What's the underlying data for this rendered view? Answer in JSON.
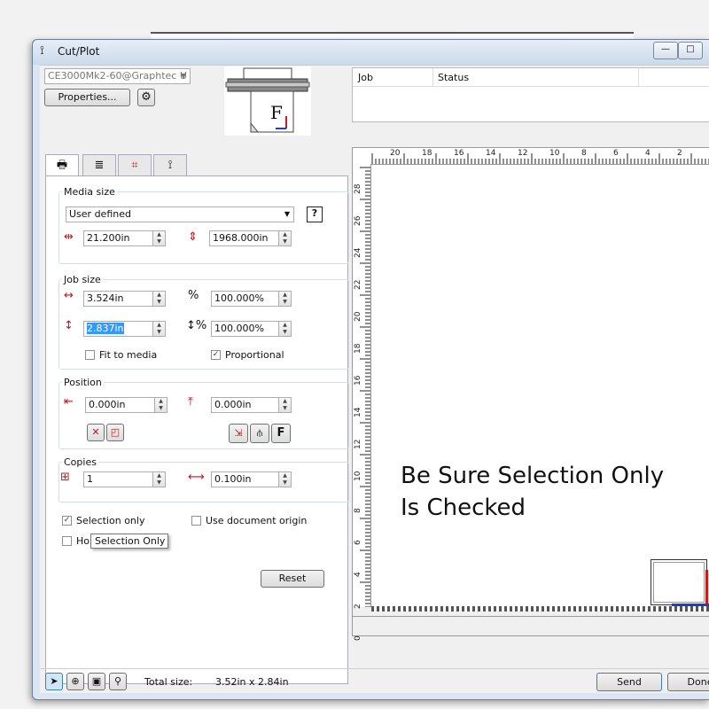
{
  "window": {
    "title": "Cut/Plot",
    "caption_buttons": {
      "minimize": "—",
      "maximize": "□"
    }
  },
  "device": {
    "selected": "CE3000Mk2-60@Graphtec U",
    "properties_label": "Properties..."
  },
  "job_list": {
    "columns": [
      "Job",
      "Status"
    ]
  },
  "media_size": {
    "label": "Media size",
    "selected": "User defined",
    "width": "21.200in",
    "height": "1968.000in"
  },
  "job_size": {
    "label": "Job size",
    "width": "3.524in",
    "height": "2.837in",
    "width_pct": "100.000%",
    "height_pct": "100.000%",
    "fit_to_media": "Fit to media",
    "proportional": "Proportional"
  },
  "position": {
    "label": "Position",
    "x": "0.000in",
    "y": "0.000in",
    "f_label": "F"
  },
  "copies": {
    "label": "Copies",
    "count": "1",
    "spacing": "0.100in"
  },
  "options": {
    "selection_only": "Selection only",
    "use_document_origin": "Use document origin",
    "hold_partial": "Hol",
    "tooltip": "Selection Only"
  },
  "reset_label": "Reset",
  "preview": {
    "top_ticks": [
      "20",
      "18",
      "16",
      "14",
      "12",
      "10",
      "8",
      "6",
      "4",
      "2"
    ],
    "side_ticks": [
      "28",
      "26",
      "24",
      "22",
      "20",
      "18",
      "16",
      "14",
      "12",
      "10",
      "8",
      "6",
      "4",
      "2",
      "0"
    ],
    "annotation_line1": "Be Sure Selection Only",
    "annotation_line2": "Is Checked",
    "icon_letter": "F"
  },
  "status_bar": {
    "total_size_label": "Total size:",
    "total_size_value": "3.52in x 2.84in",
    "send_label": "Send",
    "done_label": "Done"
  },
  "colors": {
    "accent_blue": "#3c7fb1",
    "arrow_red": "#d01818",
    "arrow_blue": "#1a3fd0"
  }
}
